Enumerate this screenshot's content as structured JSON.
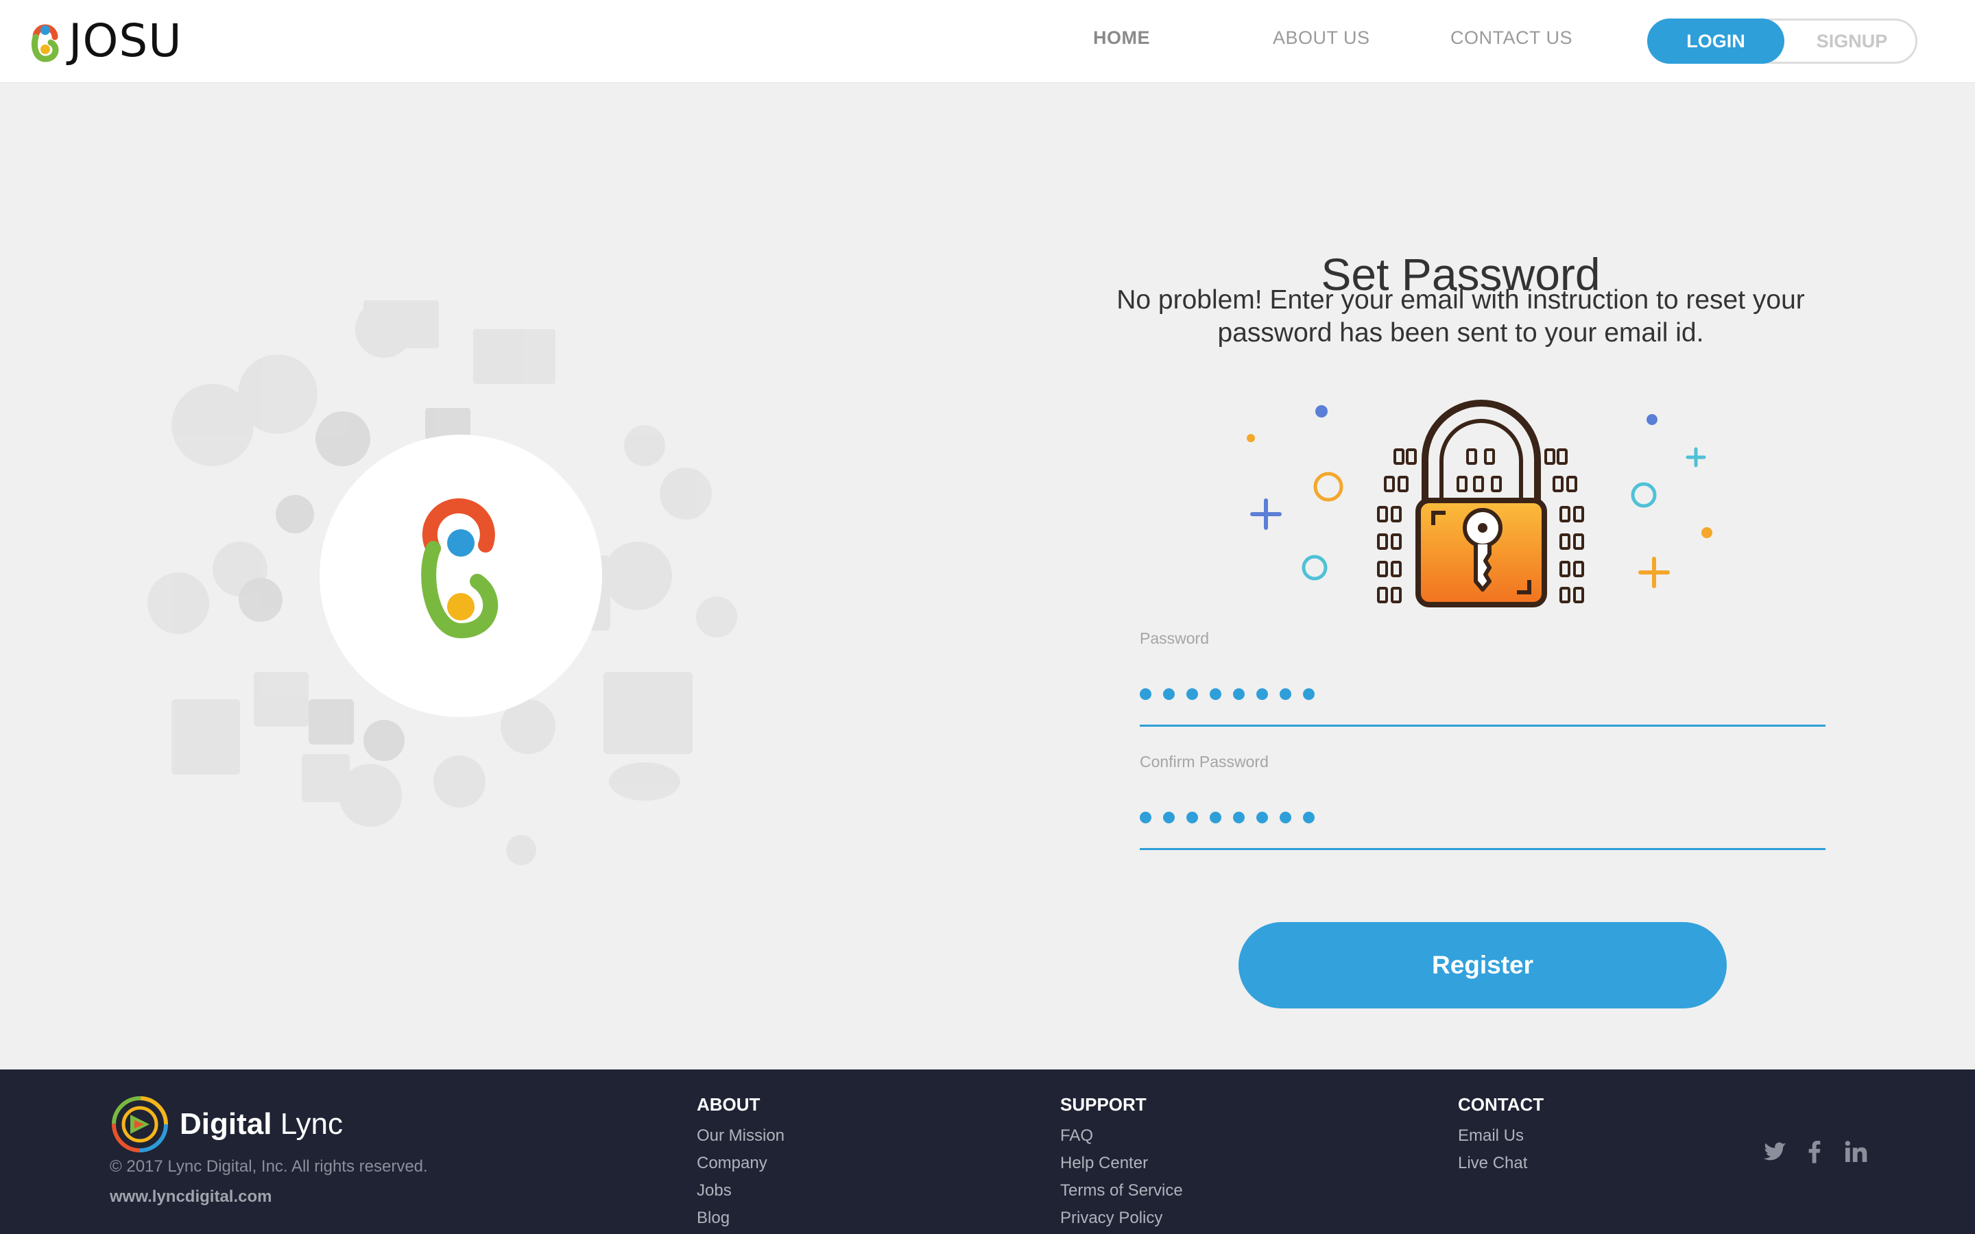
{
  "header": {
    "brand": "JOSU",
    "nav": {
      "home": "HOME",
      "about": "ABOUT US",
      "contact": "CONTACT US"
    },
    "auth": {
      "login": "LOGIN",
      "signup": "SIGNUP"
    }
  },
  "form": {
    "title": "Set Password",
    "subtitle_line1": "No problem! Enter your email with instruction to reset your",
    "subtitle_line2": "password has been sent to your email id.",
    "password_label": "Password",
    "password_length": 8,
    "confirm_label": "Confirm Password",
    "confirm_length": 8,
    "register_label": "Register"
  },
  "footer": {
    "brand_bold": "Digital",
    "brand_light": "Lync",
    "copyright": "© 2017 Lync Digital, Inc. All rights reserved.",
    "website": "www.lyncdigital.com",
    "about": {
      "heading": "ABOUT",
      "links": [
        "Our Mission",
        "Company",
        "Jobs",
        "Blog"
      ]
    },
    "support": {
      "heading": "SUPPORT",
      "links": [
        "FAQ",
        "Help Center",
        "Terms of Service",
        "Privacy Policy"
      ]
    },
    "contact": {
      "heading": "CONTACT",
      "links": [
        "Email Us",
        "Live Chat"
      ]
    },
    "social_icons": [
      "twitter-icon",
      "facebook-icon",
      "linkedin-icon"
    ]
  },
  "colors": {
    "accent": "#2e9fd9",
    "footer_bg": "#1f2333",
    "page_bg": "#f0f0f0",
    "logo_red": "#e8532b",
    "logo_blue": "#2f9ad8",
    "logo_green": "#7ab93f",
    "logo_yellow": "#f4b51c"
  }
}
